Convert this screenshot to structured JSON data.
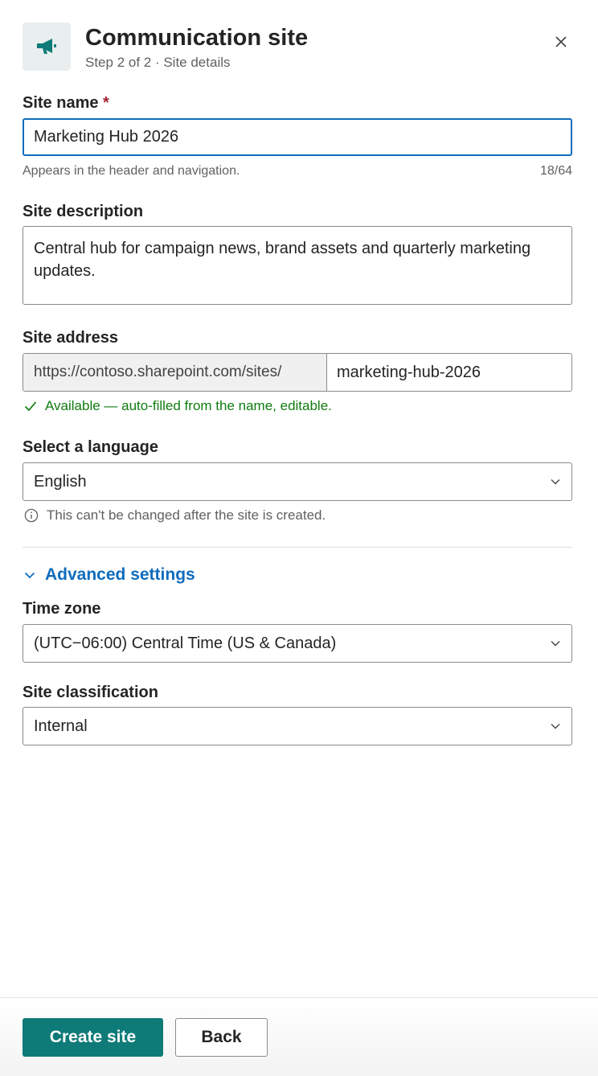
{
  "header": {
    "title": "Communication site",
    "subtitle": "Step 2 of 2 · Site details",
    "icon": "megaphone-icon",
    "close_icon": "close-icon"
  },
  "site_name": {
    "label": "Site name",
    "required_mark": "*",
    "value": "Marketing Hub 2026",
    "hint": "Appears in the header and navigation.",
    "counter": "18/64"
  },
  "site_description": {
    "label": "Site description",
    "value": "Central hub for campaign news, brand assets and quarterly marketing updates."
  },
  "site_address": {
    "label": "Site address",
    "prefix": "https://contoso.sharepoint.com/sites/",
    "slug": "marketing-hub-2026",
    "status": "Available — auto-filled from the name, editable."
  },
  "language": {
    "label": "Select a language",
    "value": "English",
    "note": "This can't be changed after the site is created."
  },
  "advanced": {
    "label": "Advanced settings",
    "expanded": true
  },
  "time_zone": {
    "label": "Time zone",
    "value": "(UTC−06:00) Central Time (US & Canada)"
  },
  "classification": {
    "label": "Site classification",
    "value": "Internal"
  },
  "footer": {
    "create_label": "Create site",
    "back_label": "Back"
  },
  "colors": {
    "accent": "#0f7b78",
    "link": "#0f6cbd",
    "success": "#107c10",
    "required": "#a4262c"
  }
}
